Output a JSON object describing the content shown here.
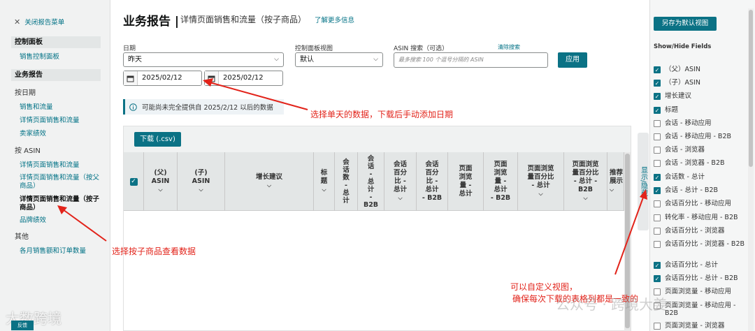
{
  "sidebar": {
    "close_menu": "关闭报告菜单",
    "dashboard_head": "控制面板",
    "sales_dashboard": "销售控制面板",
    "reports_head": "业务报告",
    "by_date": "按日期",
    "by_date_items": [
      "销售和流量",
      "详情页面销售和流量",
      "卖家绩效"
    ],
    "by_asin": "按 ASIN",
    "by_asin_item1": "详情页面销售和流量",
    "by_asin_item2": "详情页面销售和流量（按父商品）",
    "by_asin_active": "详情页面销售和流量（按子商品）",
    "brand_perf": "品牌绩效",
    "other": "其他",
    "monthly": "各月销售额和订单数量",
    "feedback": "反馈"
  },
  "header": {
    "title": "业务报告 |",
    "subtitle": "详情页面销售和流量（按子商品）",
    "learn_more": "了解更多信息"
  },
  "filters": {
    "date_label": "日期",
    "date_value": "昨天",
    "start_date": "2025/02/12",
    "end_date": "2025/02/12",
    "view_label": "控制面板视图",
    "view_value": "默认",
    "asin_label": "ASIN 搜索（可选）",
    "clear_search": "清除搜索",
    "asin_placeholder": "最多搜索 100 个逗号分隔的 ASIN",
    "apply": "应用"
  },
  "info_message": "可能尚未完全提供自 2025/2/12 以后的数据",
  "table": {
    "download": "下载 (.csv)",
    "columns": [
      "(父)\nASIN",
      "(子)\nASIN",
      "增长建议",
      "标\n题",
      "会\n话\n数\n-\n总\n计",
      "会\n话\n-\n总\n计\n-\nB2B",
      "会话\n百分\n比 -\n总计",
      "会话\n百分\n比 -\n总计\n- B2B",
      "页面\n浏览\n量 -\n总计",
      "页面\n浏览\n量 -\n总计\n- B2B",
      "页面浏览\n量百分比\n- 总计",
      "页面浏览\n量百分比\n- 总计 -\nB2B",
      "推荐\n展示"
    ],
    "side_tab": "显示/隐藏"
  },
  "right_panel": {
    "save_view": "另存为默认视图",
    "fields_title": "Show/Hide Fields",
    "fields": [
      {
        "label": "（父）ASIN",
        "checked": true
      },
      {
        "label": "（子）ASIN",
        "checked": true
      },
      {
        "label": "增长建议",
        "checked": true
      },
      {
        "label": "标题",
        "checked": true
      },
      {
        "label": "会话 - 移动应用",
        "checked": false
      },
      {
        "label": "会话 - 移动应用 - B2B",
        "checked": false
      },
      {
        "label": "会话 - 浏览器",
        "checked": false
      },
      {
        "label": "会话 - 浏览器 - B2B",
        "checked": false
      },
      {
        "label": "会话数 - 总计",
        "checked": true
      },
      {
        "label": "会话 - 总计 - B2B",
        "checked": true
      },
      {
        "label": "会话百分比 - 移动应用",
        "checked": false
      },
      {
        "label": "转化率 - 移动应用 - B2B",
        "checked": false
      },
      {
        "label": "会话百分比 - 浏览器",
        "checked": false
      },
      {
        "label": "会话百分比 - 浏览器 - B2B",
        "checked": false
      },
      {
        "label": "会话百分比 - 总计",
        "checked": true
      },
      {
        "label": "会话百分比 - 总计 - B2B",
        "checked": true
      },
      {
        "label": "页面浏览量 - 移动应用",
        "checked": false
      },
      {
        "label": "页面浏览量 - 移动应用 - B2B",
        "checked": false
      },
      {
        "label": "页面浏览量 - 浏览器",
        "checked": false
      }
    ]
  },
  "annotations": {
    "date_note": "选择单天的数据，下载后手动添加日期",
    "child_note": "选择按子商品查看数据",
    "view_note_1": "可以自定义视图，",
    "view_note_2": "确保每次下载的表格列都是一致的"
  },
  "watermarks": {
    "left": "大数跨境",
    "right": "公众号 · 跨境大姜"
  },
  "colors": {
    "accent": "#0b7285",
    "link": "#007185",
    "annotation": "#e2231a"
  }
}
